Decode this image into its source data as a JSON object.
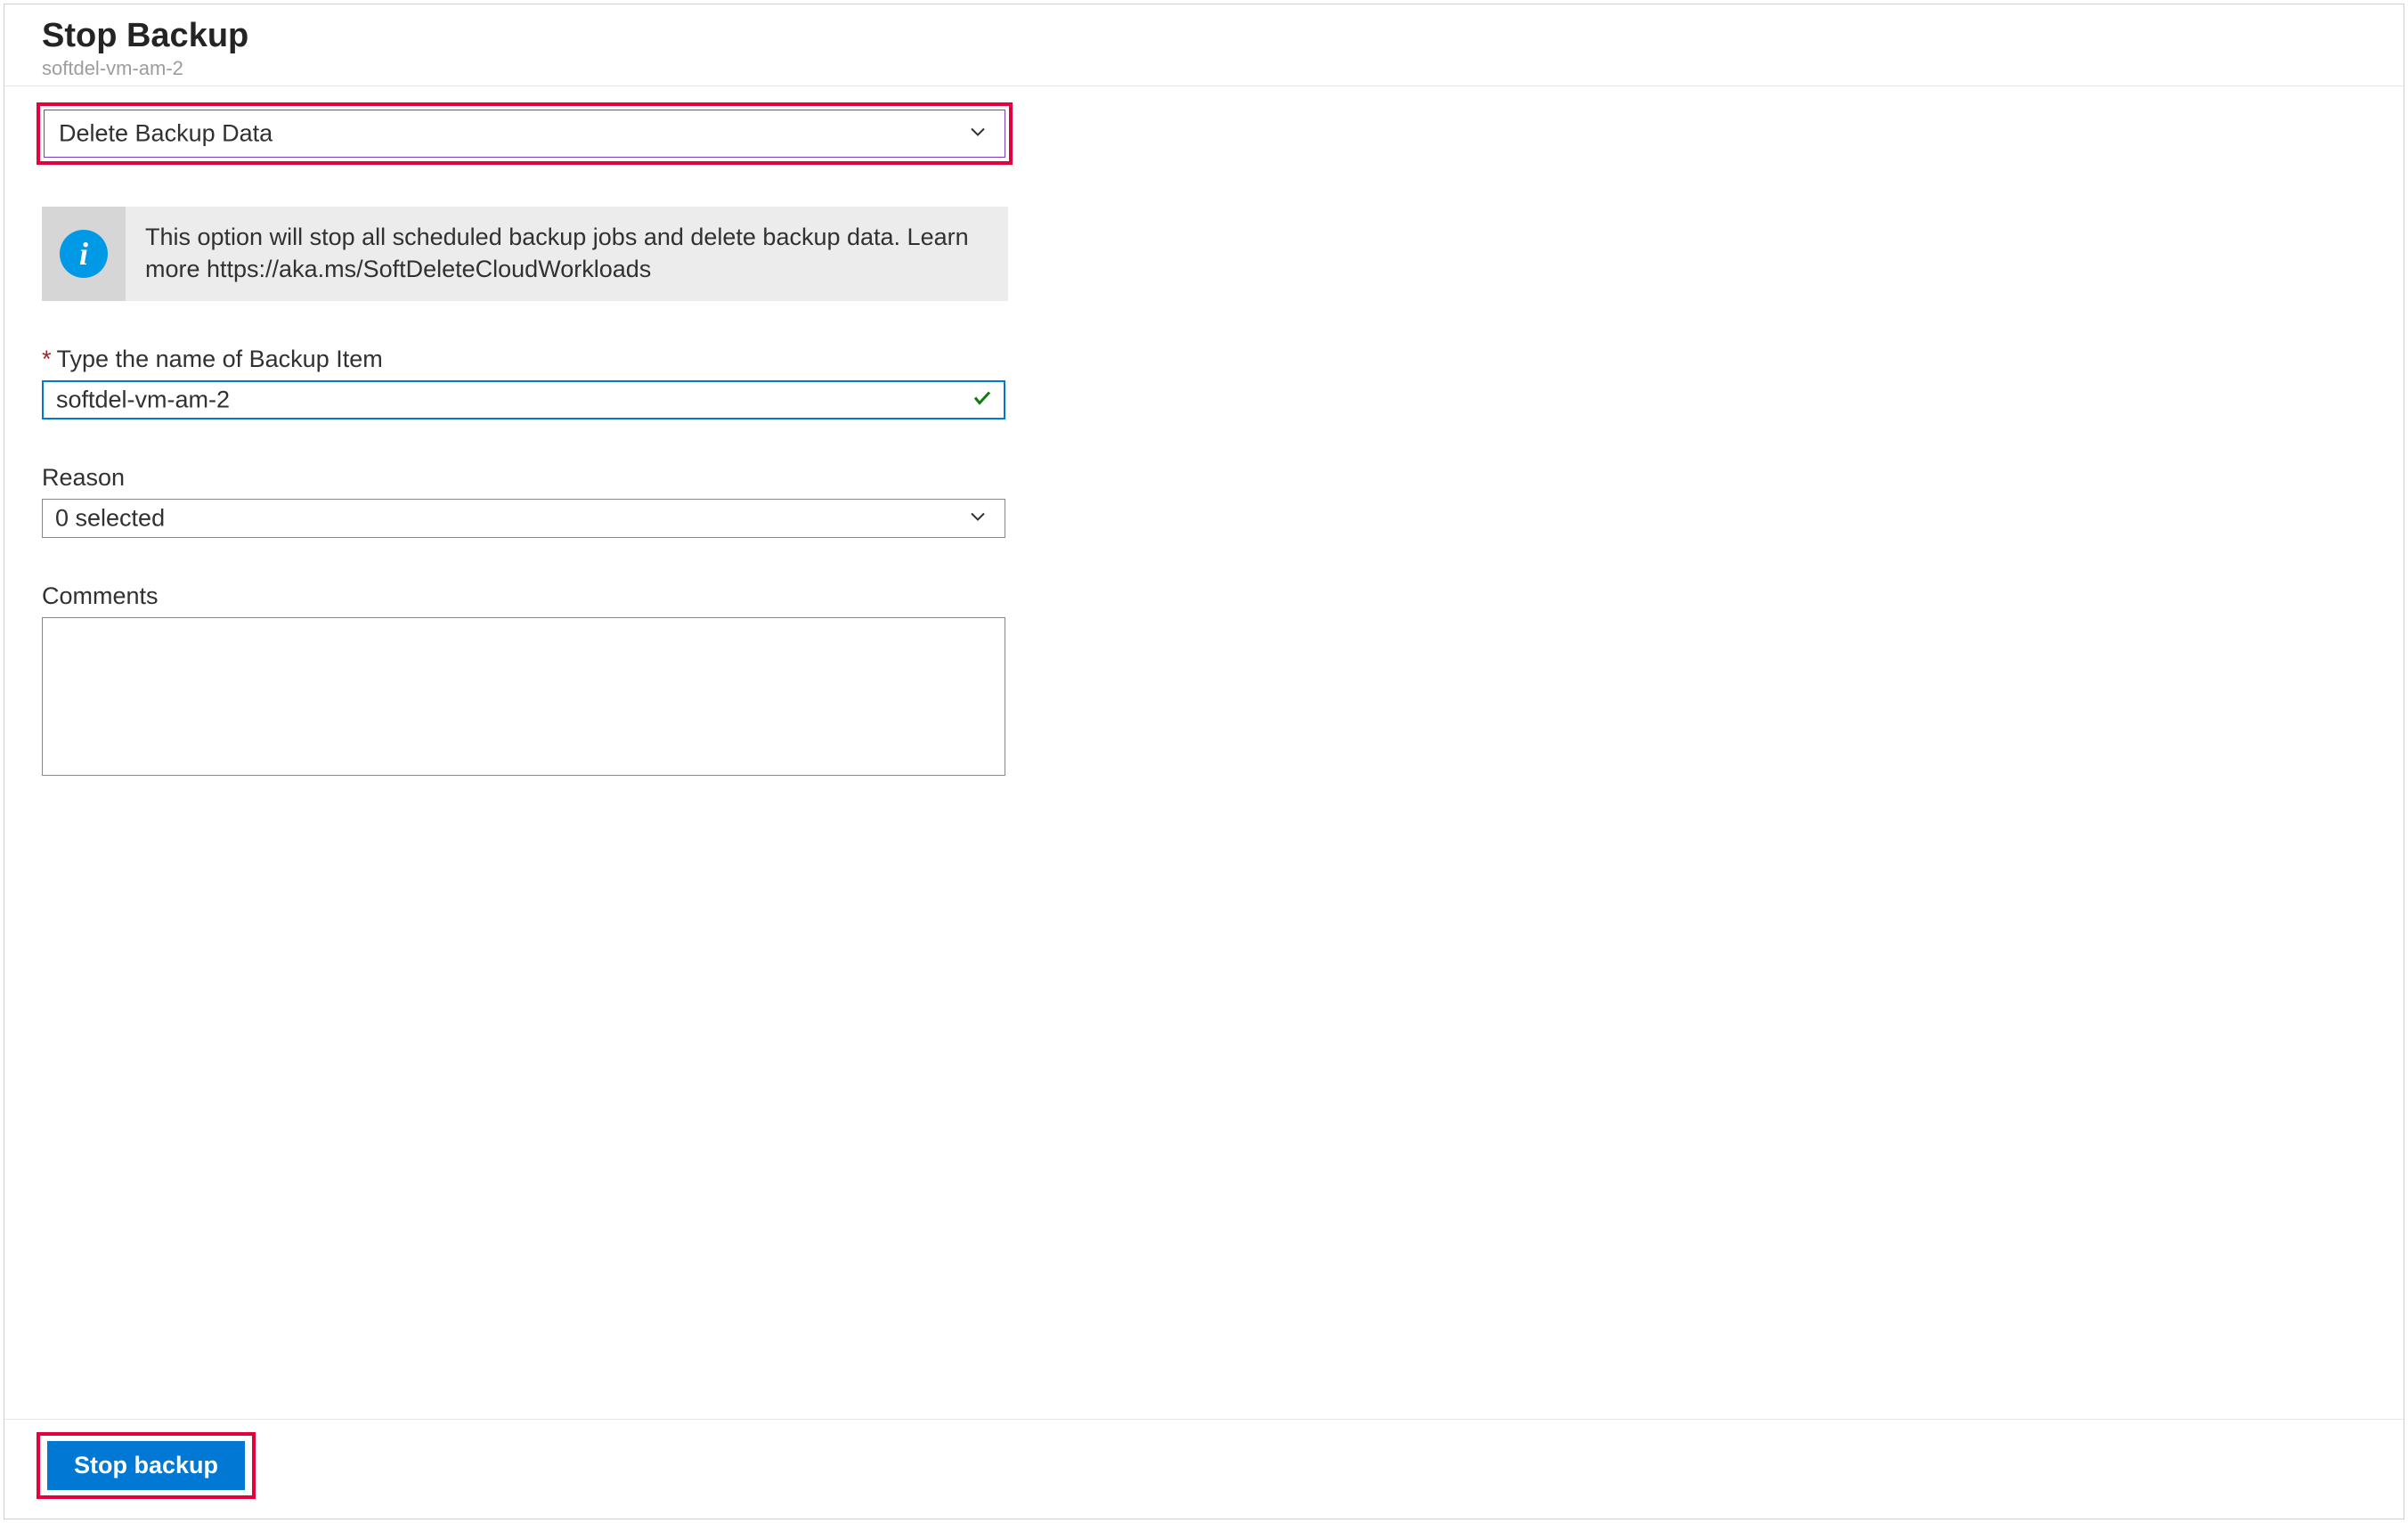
{
  "header": {
    "title": "Stop Backup",
    "subtitle": "softdel-vm-am-2"
  },
  "actionDropdown": {
    "selected": "Delete Backup Data"
  },
  "infoBox": {
    "text": "This option will stop all scheduled backup jobs and delete backup data. Learn more https://aka.ms/SoftDeleteCloudWorkloads"
  },
  "nameField": {
    "label": "Type the name of Backup Item",
    "value": "softdel-vm-am-2"
  },
  "reason": {
    "label": "Reason",
    "selected": "0 selected"
  },
  "comments": {
    "label": "Comments",
    "value": ""
  },
  "footer": {
    "stop_label": "Stop backup"
  }
}
